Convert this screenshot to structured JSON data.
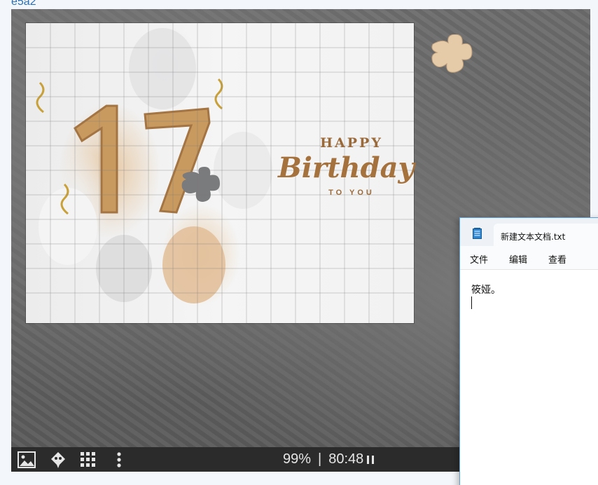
{
  "page": {
    "top_link": "e5a2"
  },
  "puzzle": {
    "art": {
      "number": "17",
      "line1": "HAPPY",
      "line2": "Birthday",
      "line3": "TO YOU"
    },
    "colors": {
      "gold": "#c79a5f",
      "board": "#666666"
    }
  },
  "toolbar": {
    "icons": [
      "image-icon",
      "ghost-icon",
      "grid-icon",
      "more-vertical-icon"
    ],
    "progress": "99%",
    "separator": "|",
    "timer": "80:48"
  },
  "notepad": {
    "tab_title": "新建文本文档.txt",
    "menu": [
      "文件",
      "编辑",
      "查看"
    ],
    "content": "筱娅。"
  }
}
